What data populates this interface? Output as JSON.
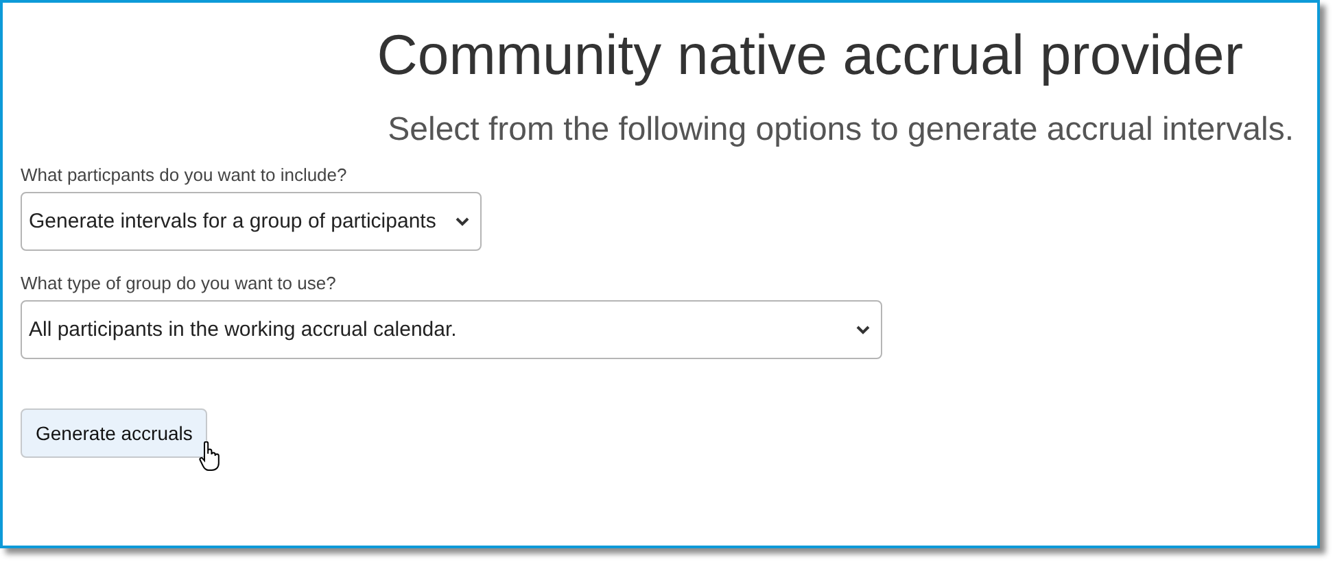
{
  "title": "Community native accrual provider",
  "subtitle": "Select from the following options to generate accrual intervals.",
  "fields": [
    {
      "label": "What particpants do you want to include?",
      "value": "Generate intervals for a group of participants"
    },
    {
      "label": "What type of group do you want to use?",
      "value": "All participants in the working accrual calendar."
    }
  ],
  "button": {
    "label": "Generate accruals",
    "hovered": true
  }
}
